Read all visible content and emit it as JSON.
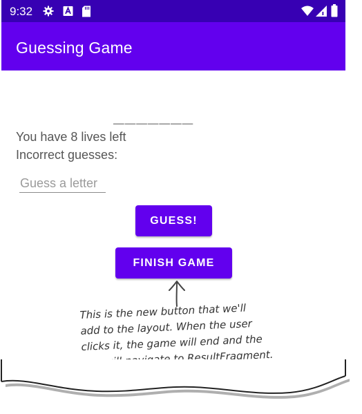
{
  "status_bar": {
    "time": "9:32",
    "left_icons": [
      "gear-icon",
      "a-box-icon",
      "sd-card-icon"
    ],
    "right_icons": [
      "wifi-icon",
      "signal-icon",
      "battery-icon"
    ],
    "color": "#3700b3"
  },
  "app_bar": {
    "title": "Guessing Game",
    "color": "#6200ee"
  },
  "game": {
    "secret_word_display": "_______",
    "lives_text": "You have 8 lives left",
    "incorrect_text": "Incorrect guesses:",
    "guess_placeholder": "Guess a letter"
  },
  "buttons": {
    "guess_label": "GUESS!",
    "finish_label": "FINISH GAME"
  },
  "annotation": {
    "lines": [
      "This is the new button that we'll",
      "add to the layout. When the user",
      "clicks it, the game will end and the",
      "app will navigate to ResultFragment."
    ]
  }
}
